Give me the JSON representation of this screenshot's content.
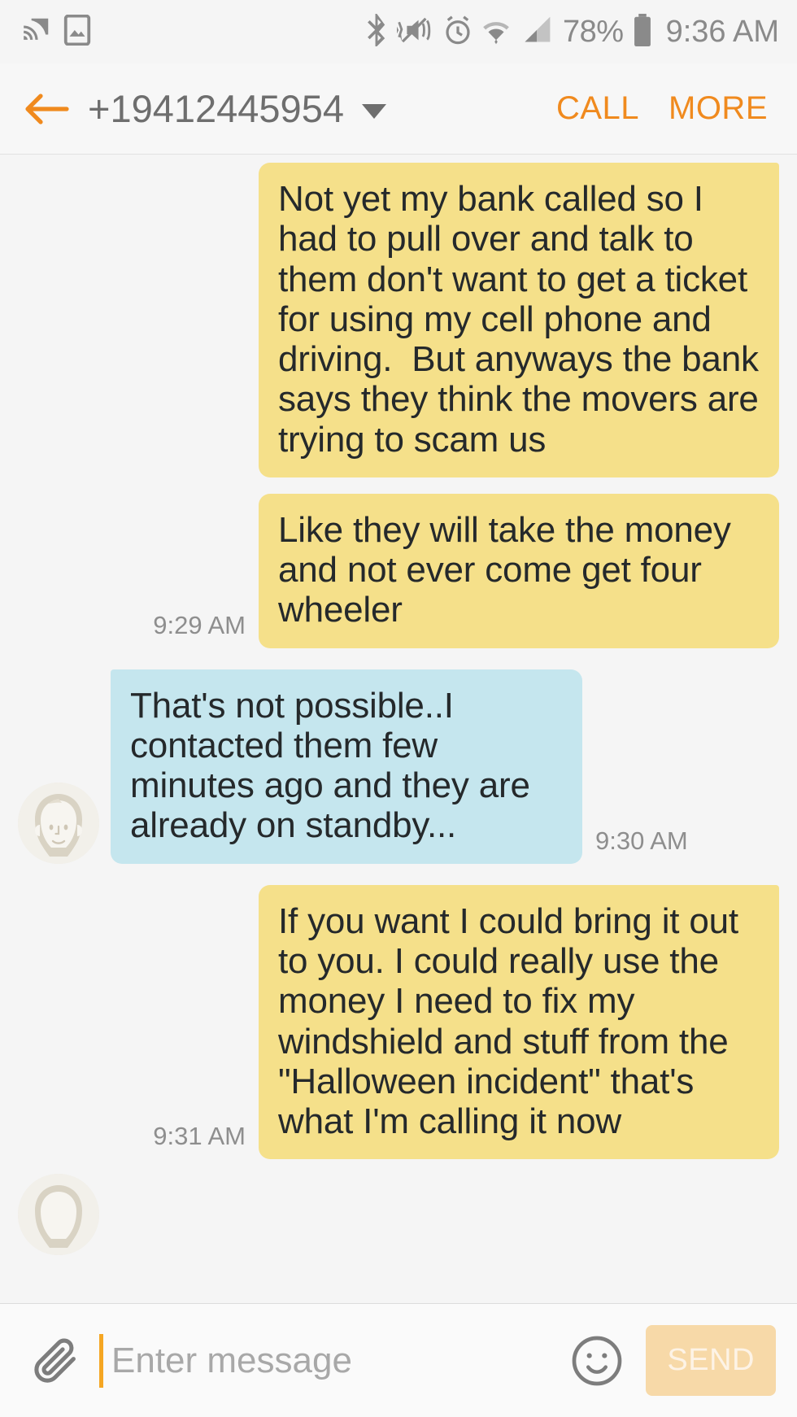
{
  "status_bar": {
    "left_icons": [
      "cast-icon",
      "screenshot-icon"
    ],
    "right_icons": [
      "bluetooth-icon",
      "vibrate-mute-icon",
      "alarm-icon",
      "wifi-icon",
      "signal-icon"
    ],
    "battery_percent": "78%",
    "battery_icon": "battery-icon",
    "clock": "9:36 AM"
  },
  "app_bar": {
    "back_icon": "back-arrow-icon",
    "title": "+19412445954",
    "caret_icon": "chevron-down-icon",
    "call_label": "CALL",
    "more_label": "MORE",
    "accent_color": "#f08a1e",
    "title_color": "#6e6e6e"
  },
  "thread": {
    "messages": [
      {
        "id": 1,
        "direction": "outgoing",
        "text": "Not yet my bank called so I had to pull over and talk to them don't want to get a ticket for using my cell phone and driving.  But anyways the bank says they think the movers are trying to scam us",
        "timestamp": "",
        "bubble_color": "#f5e08a"
      },
      {
        "id": 2,
        "direction": "outgoing",
        "text": "Like they will take the money and not ever come get four wheeler",
        "timestamp": "9:29 AM",
        "bubble_color": "#f5e08a"
      },
      {
        "id": 3,
        "direction": "incoming",
        "text": "That's not possible..I contacted them few minutes ago and they are already on standby...",
        "timestamp": "9:30 AM",
        "bubble_color": "#c5e6ee",
        "avatar": "contact-avatar-icon"
      },
      {
        "id": 4,
        "direction": "outgoing",
        "text": "If you want I could bring it out to you. I could really use the money I need to fix my windshield and stuff from the \"Halloween incident\" that's what I'm calling it now",
        "timestamp": "9:31 AM",
        "bubble_color": "#f5e08a"
      },
      {
        "id": 5,
        "direction": "incoming",
        "text": "",
        "timestamp": "",
        "bubble_color": "#c5e6ee",
        "avatar": "contact-avatar-icon",
        "partially_visible": true
      }
    ]
  },
  "composer": {
    "attach_icon": "paperclip-icon",
    "input_value": "",
    "placeholder": "Enter message",
    "emoji_icon": "smiley-icon",
    "send_label": "SEND",
    "send_bg_color": "#f7d9a8",
    "cursor_color": "#f5a623"
  }
}
